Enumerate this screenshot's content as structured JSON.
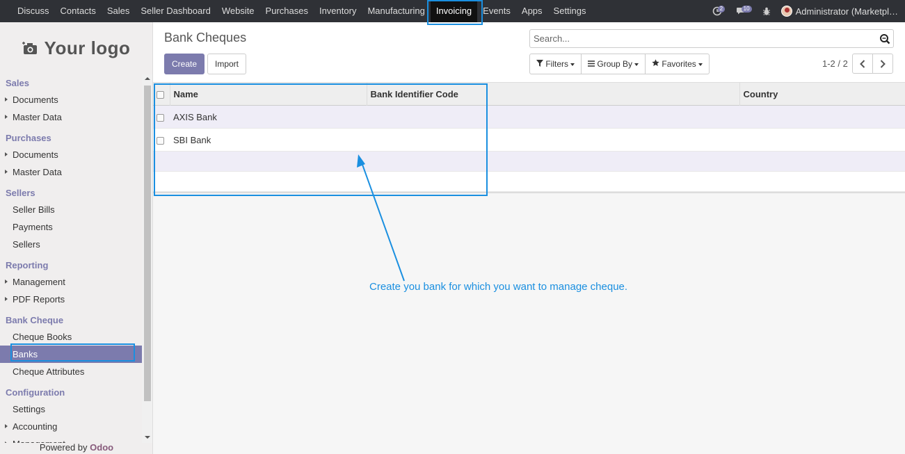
{
  "topnav": {
    "menu": [
      "Discuss",
      "Contacts",
      "Sales",
      "Seller Dashboard",
      "Website",
      "Purchases",
      "Inventory",
      "Manufacturing",
      "Invoicing",
      "Events",
      "Apps",
      "Settings"
    ],
    "active": "Invoicing",
    "activity_count": "2",
    "messages_count": "10",
    "user": "Administrator (Marketpl…"
  },
  "sidebar": {
    "logo_text": "Your logo",
    "sections": [
      {
        "title": "Sales",
        "items": [
          {
            "label": "Documents",
            "caret": true
          },
          {
            "label": "Master Data",
            "caret": true
          }
        ]
      },
      {
        "title": "Purchases",
        "items": [
          {
            "label": "Documents",
            "caret": true
          },
          {
            "label": "Master Data",
            "caret": true
          }
        ]
      },
      {
        "title": "Sellers",
        "items": [
          {
            "label": "Seller Bills",
            "caret": false
          },
          {
            "label": "Payments",
            "caret": false
          },
          {
            "label": "Sellers",
            "caret": false
          }
        ]
      },
      {
        "title": "Reporting",
        "items": [
          {
            "label": "Management",
            "caret": true
          },
          {
            "label": "PDF Reports",
            "caret": true
          }
        ]
      },
      {
        "title": "Bank Cheque",
        "items": [
          {
            "label": "Cheque Books",
            "caret": false
          },
          {
            "label": "Banks",
            "caret": false,
            "active": true
          },
          {
            "label": "Cheque Attributes",
            "caret": false
          }
        ]
      },
      {
        "title": "Configuration",
        "items": [
          {
            "label": "Settings",
            "caret": false
          },
          {
            "label": "Accounting",
            "caret": true
          },
          {
            "label": "Management",
            "caret": true
          }
        ]
      }
    ],
    "powered_by": "Powered by",
    "powered_brand": "Odoo"
  },
  "control_panel": {
    "breadcrumb": "Bank Cheques",
    "create_label": "Create",
    "import_label": "Import",
    "search_placeholder": "Search...",
    "filters_label": "Filters",
    "groupby_label": "Group By",
    "favorites_label": "Favorites",
    "pager": "1-2 / 2"
  },
  "table": {
    "columns": [
      "Name",
      "Bank Identifier Code",
      "Country"
    ],
    "rows": [
      {
        "name": "AXIS Bank",
        "bic": "",
        "country": ""
      },
      {
        "name": "SBI Bank",
        "bic": "",
        "country": ""
      }
    ]
  },
  "annotation": {
    "text": "Create you bank for which you want to manage cheque.",
    "color": "#1a8fe0"
  },
  "colors": {
    "brand": "#7c7bad",
    "navbar": "#2f3136"
  }
}
